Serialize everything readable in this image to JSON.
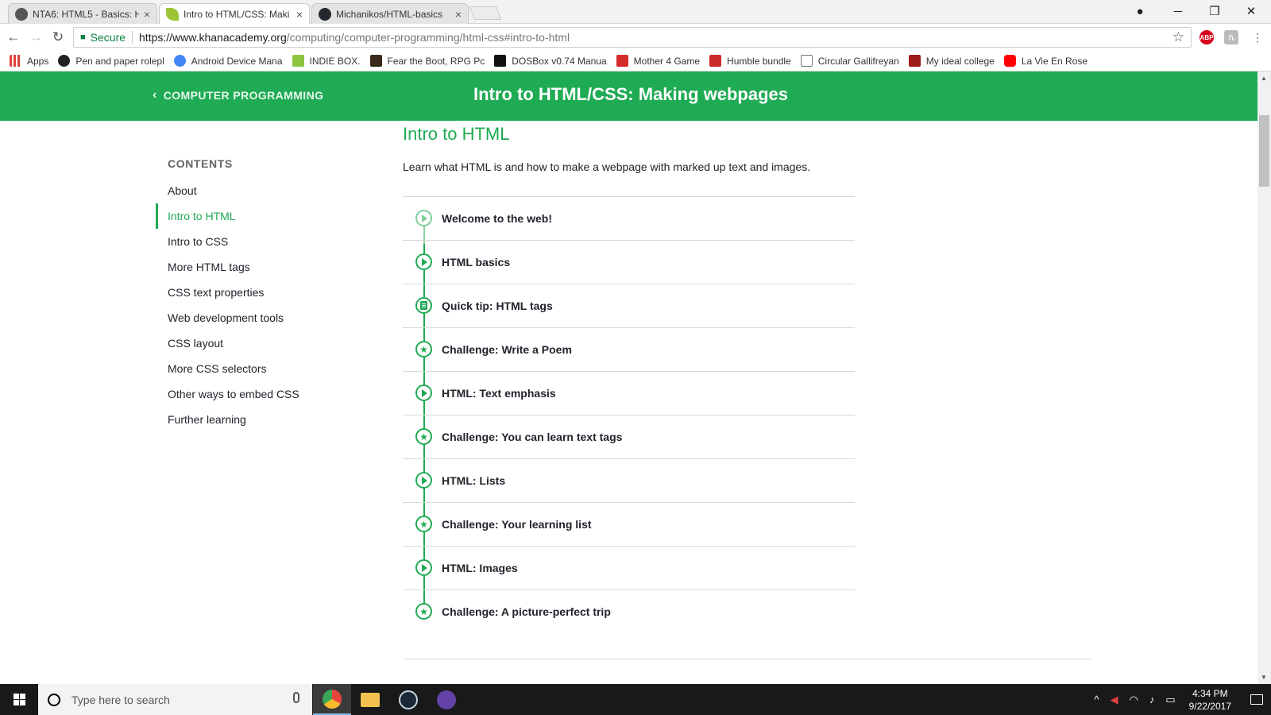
{
  "browser": {
    "tabs": [
      {
        "title": "NTA6: HTML5 - Basics: H",
        "favicon_color": "#555555",
        "active": false
      },
      {
        "title": "Intro to HTML/CSS: Maki",
        "favicon_color": "#9cc536",
        "active": true
      },
      {
        "title": "Michanikos/HTML-basics",
        "favicon_color": "#24292e",
        "active": false
      }
    ],
    "tab_close": "×",
    "address": {
      "secure_label": "Secure",
      "url_host": "https://www.khanacademy.org",
      "url_path": "/computing/computer-programming/html-css#intro-to-html"
    },
    "extensions": [
      {
        "name": "adblock-plus",
        "label": "ABP",
        "color": "#d5001c"
      },
      {
        "name": "extension-2",
        "label": "九",
        "color": "#bbbbbb"
      }
    ],
    "bookmarks": [
      {
        "label": "Apps",
        "icon_color": "#e0403a"
      },
      {
        "label": "Pen and paper rolepl",
        "icon_color": "#222222"
      },
      {
        "label": "Android Device Mana",
        "icon_color": "#4285f4"
      },
      {
        "label": "INDIE BOX.",
        "icon_color": "#8cc63f"
      },
      {
        "label": "Fear the Boot, RPG Pc",
        "icon_color": "#3a2a1a"
      },
      {
        "label": "DOSBox v0.74 Manua",
        "icon_color": "#111111"
      },
      {
        "label": "Mother 4 Game",
        "icon_color": "#d42a2a"
      },
      {
        "label": "Humble bundle",
        "icon_color": "#cc2929"
      },
      {
        "label": "Circular Gallifreyan",
        "icon_color": "#ffffff"
      },
      {
        "label": "My ideal college",
        "icon_color": "#a01c1c"
      },
      {
        "label": "La Vie En Rose",
        "icon_color": "#ff0000"
      }
    ]
  },
  "page": {
    "header": {
      "back_label": "COMPUTER PROGRAMMING",
      "course_title": "Intro to HTML/CSS: Making webpages",
      "color": "#1fab54"
    },
    "sidebar": {
      "heading": "CONTENTS",
      "items": [
        {
          "label": "About"
        },
        {
          "label": "Intro to HTML",
          "active": true
        },
        {
          "label": "Intro to CSS"
        },
        {
          "label": "More HTML tags"
        },
        {
          "label": "CSS text properties"
        },
        {
          "label": "Web development tools"
        },
        {
          "label": "CSS layout"
        },
        {
          "label": "More CSS selectors"
        },
        {
          "label": "Other ways to embed CSS"
        },
        {
          "label": "Further learning"
        }
      ]
    },
    "unit": {
      "title": "Intro to HTML",
      "description": "Learn what HTML is and how to make a webpage with marked up text and images.",
      "lessons": [
        {
          "label": "Welcome to the web!",
          "icon": "play-icon"
        },
        {
          "label": "HTML basics",
          "icon": "play-icon"
        },
        {
          "label": "Quick tip: HTML tags",
          "icon": "article-icon"
        },
        {
          "label": "Challenge: Write a Poem",
          "icon": "star-icon"
        },
        {
          "label": "HTML: Text emphasis",
          "icon": "play-icon"
        },
        {
          "label": "Challenge: You can learn text tags",
          "icon": "star-icon"
        },
        {
          "label": "HTML: Lists",
          "icon": "play-icon"
        },
        {
          "label": "Challenge: Your learning list",
          "icon": "star-icon"
        },
        {
          "label": "HTML: Images",
          "icon": "play-icon"
        },
        {
          "label": "Challenge: A picture-perfect trip",
          "icon": "star-icon"
        }
      ]
    }
  },
  "taskbar": {
    "search_placeholder": "Type here to search",
    "apps": [
      {
        "name": "chrome",
        "color": "#e8453c",
        "active": true
      },
      {
        "name": "file-explorer",
        "color": "#f2c14e",
        "active": false
      },
      {
        "name": "steam",
        "color": "#1b2838",
        "active": false
      },
      {
        "name": "twitch-app",
        "color": "#6441a4",
        "active": false
      }
    ],
    "time": "4:34 PM",
    "date": "9/22/2017"
  }
}
